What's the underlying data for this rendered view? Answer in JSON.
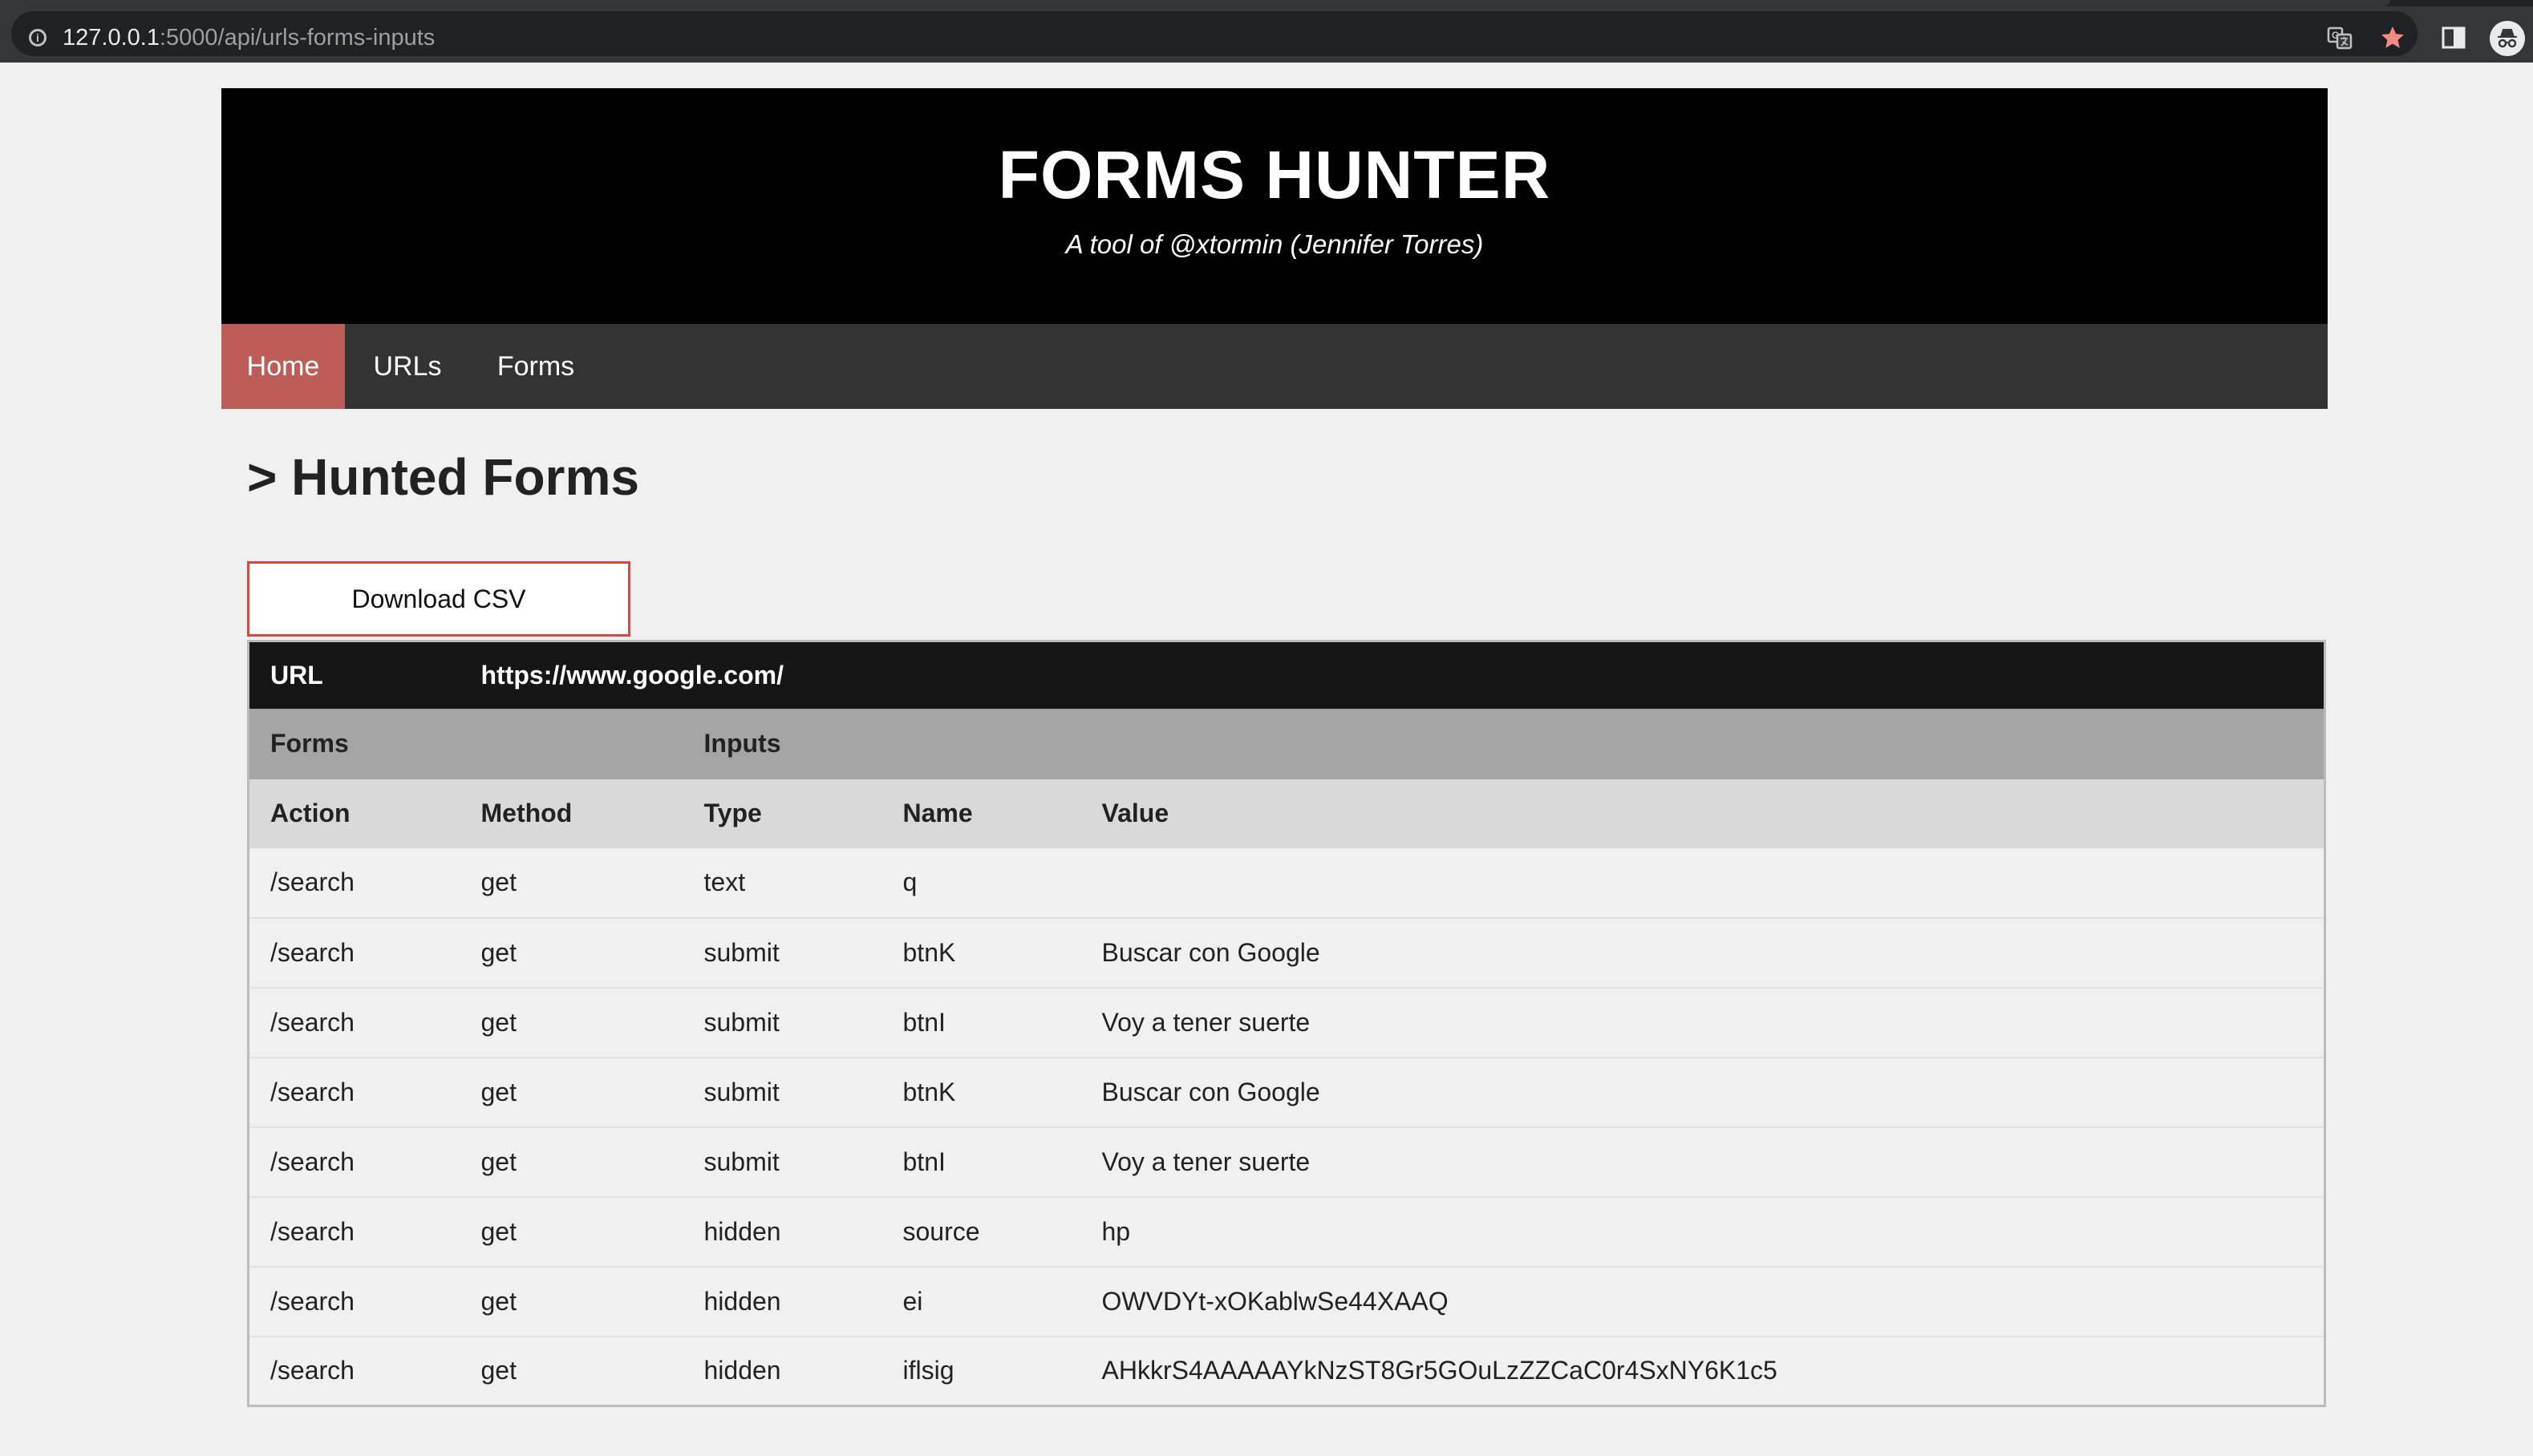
{
  "browser": {
    "url_host": "127.0.0.1",
    "url_path": ":5000/api/urls-forms-inputs",
    "icons": [
      "info-icon",
      "translate-icon",
      "star-icon",
      "side-panel-icon",
      "incognito-icon"
    ],
    "star_color": "#f28b82"
  },
  "header": {
    "title": "FORMS HUNTER",
    "subtitle": "A tool of @xtormin (Jennifer Torres)"
  },
  "nav": {
    "items": [
      {
        "label": "Home",
        "active": true
      },
      {
        "label": "URLs",
        "active": false
      },
      {
        "label": "Forms",
        "active": false
      }
    ],
    "active_color": "#bd5d58"
  },
  "main": {
    "heading": "> Hunted Forms",
    "download_label": "Download CSV"
  },
  "table": {
    "url_label": "URL",
    "url_value": "https://www.google.com/",
    "group_headers": {
      "forms": "Forms",
      "inputs": "Inputs"
    },
    "columns": [
      "Action",
      "Method",
      "Type",
      "Name",
      "Value"
    ],
    "rows": [
      [
        "/search",
        "get",
        "text",
        "q",
        ""
      ],
      [
        "/search",
        "get",
        "submit",
        "btnK",
        "Buscar con Google"
      ],
      [
        "/search",
        "get",
        "submit",
        "btnI",
        "Voy a tener suerte"
      ],
      [
        "/search",
        "get",
        "submit",
        "btnK",
        "Buscar con Google"
      ],
      [
        "/search",
        "get",
        "submit",
        "btnI",
        "Voy a tener suerte"
      ],
      [
        "/search",
        "get",
        "hidden",
        "source",
        "hp"
      ],
      [
        "/search",
        "get",
        "hidden",
        "ei",
        "OWVDYt-xOKablwSe44XAAQ"
      ],
      [
        "/search",
        "get",
        "hidden",
        "iflsig",
        "AHkkrS4AAAAAYkNzST8Gr5GOuLzZZCaC0r4SxNY6K1c5"
      ]
    ]
  }
}
